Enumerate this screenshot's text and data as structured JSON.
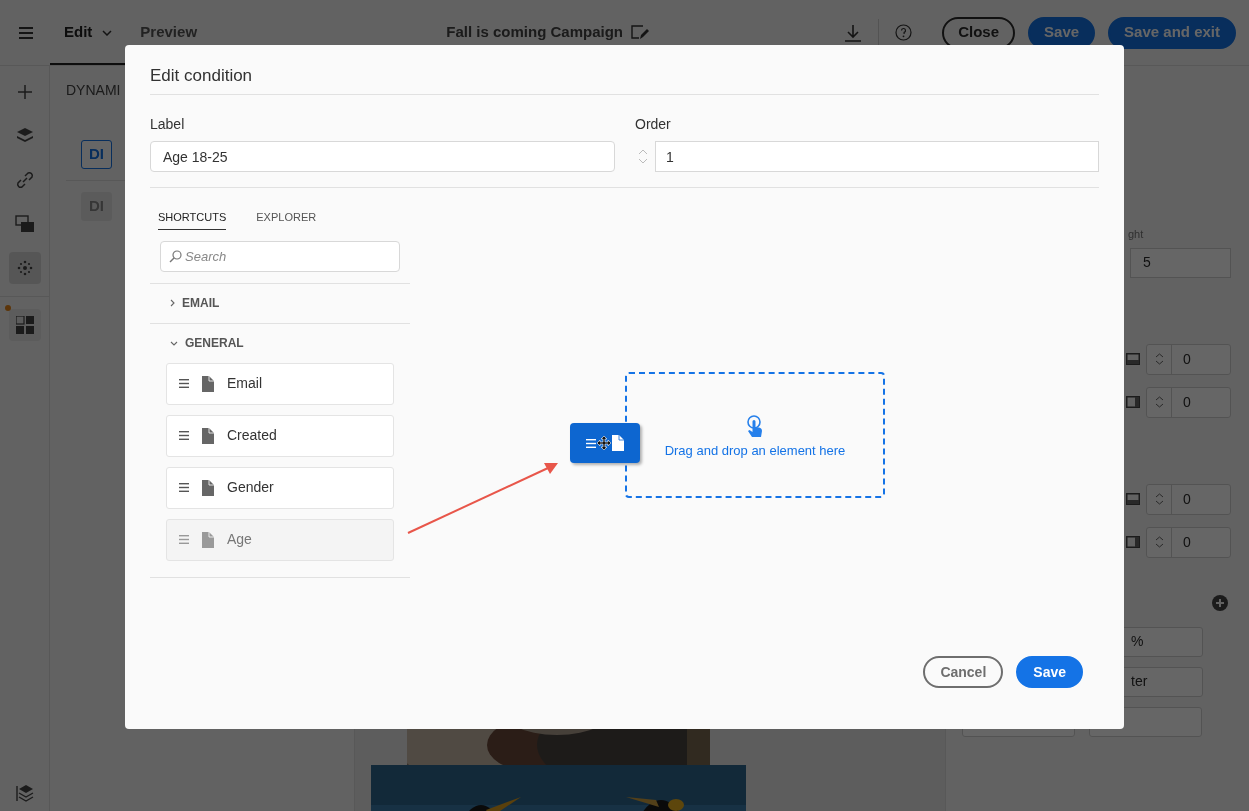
{
  "app_bar": {
    "tabs": [
      {
        "label": "Edit",
        "selected": true
      },
      {
        "label": "Preview",
        "selected": false
      }
    ],
    "title": "Fall is coming Campaign",
    "buttons": [
      {
        "label": "Close",
        "kind": "outline"
      },
      {
        "label": "Save",
        "kind": "primary"
      },
      {
        "label": "Save and exit",
        "kind": "primary"
      }
    ]
  },
  "panel": {
    "heading": "DYNAMI",
    "items": [
      {
        "label": "DI",
        "selected": true
      },
      {
        "label": "DI",
        "selected": false
      }
    ]
  },
  "properties": {
    "label": "ght",
    "value": "5",
    "spinners": [
      "0",
      "0",
      "0",
      "0"
    ],
    "fields": [
      "%",
      "ter"
    ]
  },
  "dialog": {
    "title": "Edit condition",
    "label_field": {
      "label": "Label",
      "value": "Age 18-25"
    },
    "order_field": {
      "label": "Order",
      "value": "1"
    },
    "tabs": [
      {
        "label": "SHORTCUTS",
        "selected": true
      },
      {
        "label": "EXPLORER",
        "selected": false
      }
    ],
    "search": {
      "placeholder": "Search"
    },
    "groups": [
      {
        "label": "EMAIL",
        "expanded": false
      },
      {
        "label": "GENERAL",
        "expanded": true,
        "items": [
          {
            "label": "Email",
            "dragging": false
          },
          {
            "label": "Created",
            "dragging": false
          },
          {
            "label": "Gender",
            "dragging": false
          },
          {
            "label": "Age",
            "dragging": true
          }
        ]
      }
    ],
    "drop_zone": {
      "text": "Drag and drop an element here"
    },
    "buttons": [
      {
        "label": "Cancel",
        "kind": "secondary"
      },
      {
        "label": "Save",
        "kind": "primary"
      }
    ]
  }
}
